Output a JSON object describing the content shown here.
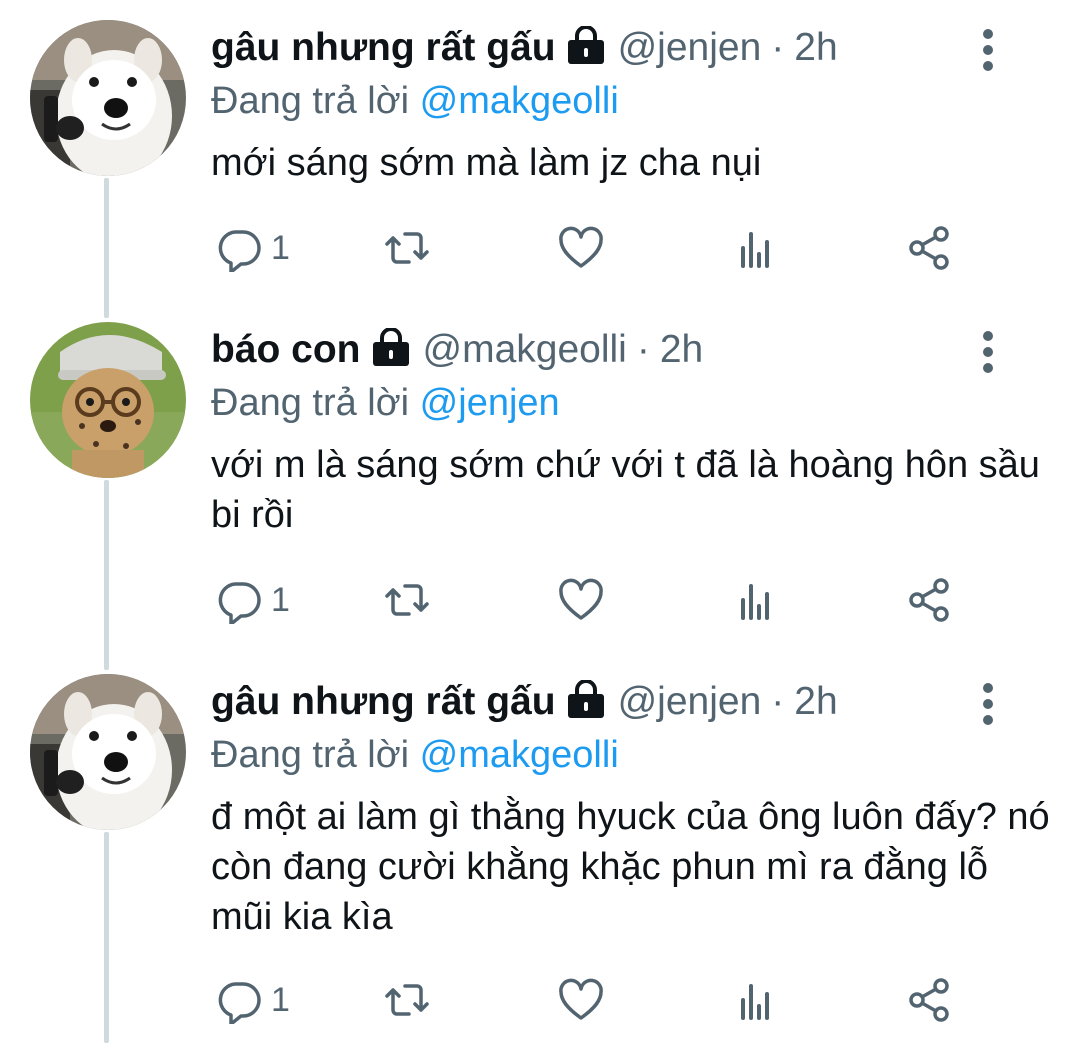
{
  "thread": {
    "tweets": [
      {
        "display_name": "gâu nhưng rất gấu",
        "protected_icon": "lock-icon",
        "handle": "@jenjen",
        "separator": "·",
        "time": "2h",
        "replying_prefix": "Đang trả lời",
        "replying_to": "@makgeolli",
        "text": "mới sáng sớm mà làm jz cha nụi",
        "avatar": "samoyed-dog-avatar",
        "stats": {
          "replies": "1",
          "retweets": "",
          "likes": ""
        }
      },
      {
        "display_name": "báo con",
        "protected_icon": "lock-icon",
        "handle": "@makgeolli",
        "separator": "·",
        "time": "2h",
        "replying_prefix": "Đang trả lời",
        "replying_to": "@jenjen",
        "text": "với m là sáng sớm chứ với t đã là hoàng hôn sầu bi rồi",
        "avatar": "cheetah-cub-avatar",
        "stats": {
          "replies": "1",
          "retweets": "",
          "likes": ""
        }
      },
      {
        "display_name": "gâu nhưng rất gấu",
        "protected_icon": "lock-icon",
        "handle": "@jenjen",
        "separator": "·",
        "time": "2h",
        "replying_prefix": "Đang trả lời",
        "replying_to": "@makgeolli",
        "text": "đ một ai làm gì thằng hyuck của ông luôn đấy? nó còn đang cười khằng khặc phun mì ra đằng lỗ mũi kia kìa",
        "avatar": "samoyed-dog-avatar",
        "stats": {
          "replies": "1",
          "retweets": "",
          "likes": ""
        }
      }
    ]
  },
  "colors": {
    "text_primary": "#0f1419",
    "text_secondary": "#536471",
    "accent": "#1d9bf0",
    "thread_line": "#cfd9de"
  }
}
